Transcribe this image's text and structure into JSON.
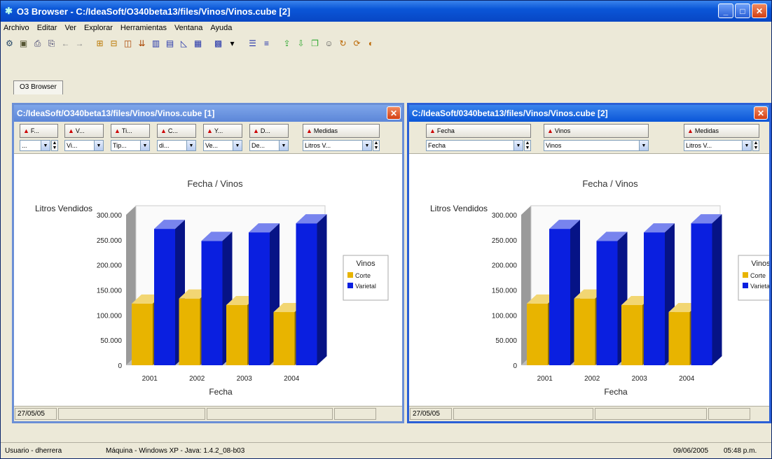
{
  "app": {
    "title": "O3 Browser - C:/IdeaSoft/O340beta13/files/Vinos/Vinos.cube [2]",
    "tab": "O3 Browser"
  },
  "window_buttons": {
    "minimize": "_",
    "maximize": "□",
    "close": "✕"
  },
  "menu": [
    "Archivo",
    "Editar",
    "Ver",
    "Explorar",
    "Herramientas",
    "Ventana",
    "Ayuda"
  ],
  "toolbar_icons": [
    "gear-icon",
    "camera-icon",
    "print-icon",
    "print-preview-icon",
    "back-icon",
    "forward-icon",
    "pivot-icon",
    "filter-icon",
    "cube-icon",
    "drill-icon",
    "bar-chart-icon",
    "line-chart-icon",
    "area-chart-icon",
    "table-icon",
    "chart-icon",
    "dropdown-icon",
    "align-left-icon",
    "align-right-icon",
    "export-icon",
    "import-icon",
    "copy-icon",
    "user-icon",
    "refresh-icon",
    "sync-icon",
    "color-icon"
  ],
  "window1": {
    "title": "C:/IdeaSoft/O340beta13/files/Vinos/Vinos.cube [1]",
    "dims": [
      {
        "label": "F...",
        "value": "..."
      },
      {
        "label": "V...",
        "value": "Vi..."
      },
      {
        "label": "Ti...",
        "value": "Tip..."
      },
      {
        "label": "C...",
        "value": "di..."
      },
      {
        "label": "Y...",
        "value": "Ve..."
      },
      {
        "label": "D...",
        "value": "De..."
      }
    ],
    "measure": {
      "label": "Medidas",
      "value": "Litros V..."
    },
    "status_date": "27/05/05"
  },
  "window2": {
    "title": "C:/IdeaSoft/0340beta13/files/Vinos/Vinos.cube [2]",
    "dims": [
      {
        "label": "Fecha",
        "value": "Fecha"
      },
      {
        "label": "Vinos",
        "value": "Vinos"
      }
    ],
    "measure": {
      "label": "Medidas",
      "value": "Litros V..."
    },
    "status_date": "27/05/05"
  },
  "chart_data": [
    {
      "type": "bar",
      "title": "Fecha / Vinos",
      "xlabel": "Fecha",
      "ylabel": "Litros Vendidos",
      "categories": [
        "2001",
        "2002",
        "2003",
        "2004"
      ],
      "series": [
        {
          "name": "Corte",
          "values": [
            123000,
            133000,
            120000,
            106000
          ],
          "color": "#e8b400"
        },
        {
          "name": "Varietal",
          "values": [
            272000,
            248000,
            265000,
            283000
          ],
          "color": "#0a1fe0"
        }
      ],
      "ylim": [
        0,
        300000
      ],
      "yticks": [
        "0",
        "50.000",
        "100.000",
        "150.000",
        "200.000",
        "250.000",
        "300.000"
      ],
      "legend_title": "Vinos",
      "legend": "right"
    },
    {
      "type": "bar",
      "title": "Fecha / Vinos",
      "xlabel": "Fecha",
      "ylabel": "Litros Vendidos",
      "categories": [
        "2001",
        "2002",
        "2003",
        "2004"
      ],
      "series": [
        {
          "name": "Corte",
          "values": [
            123000,
            133000,
            120000,
            106000
          ],
          "color": "#e8b400"
        },
        {
          "name": "Varietal",
          "values": [
            272000,
            248000,
            265000,
            283000
          ],
          "color": "#0a1fe0"
        }
      ],
      "ylim": [
        0,
        300000
      ],
      "yticks": [
        "0",
        "50.000",
        "100.000",
        "150.000",
        "200.000",
        "250.000",
        "300.000"
      ],
      "legend_title": "Vinos",
      "legend": "right"
    }
  ],
  "status": {
    "user": "Usuario - dherrera",
    "machine": "Máquina - Windows XP - Java: 1.4.2_08-b03",
    "date": "09/06/2005",
    "time": "05:48 p.m."
  }
}
